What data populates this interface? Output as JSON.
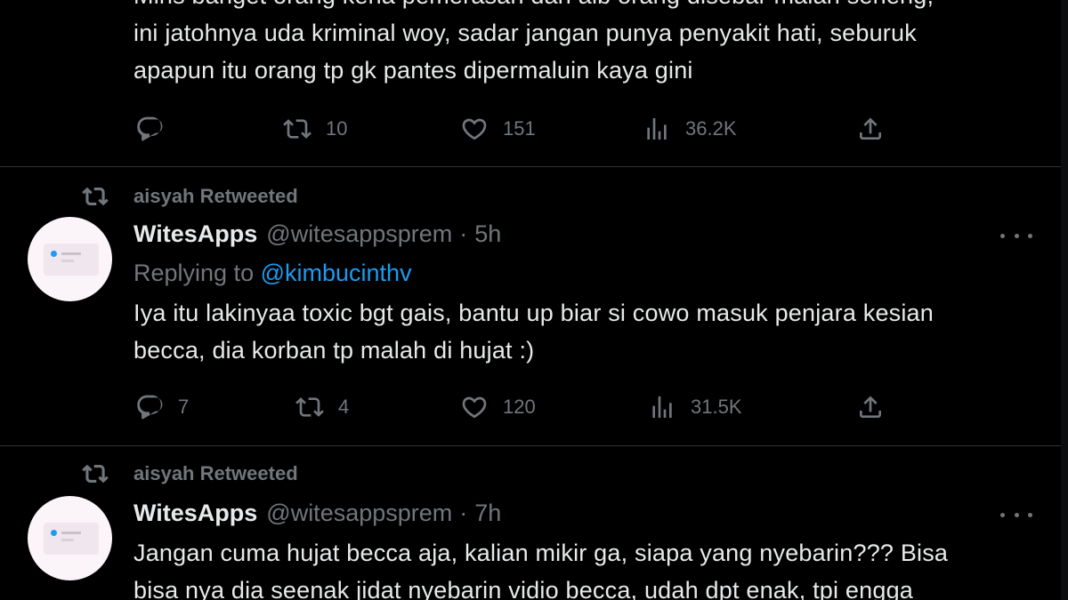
{
  "top_tweet": {
    "lines": [
      "Mihs banget orang kena pemerasan dan aib orang disebar malah seneng,",
      "ini jatohnya uda kriminal woy, sadar jangan punya penyakit hati, seburuk",
      "apapun itu orang tp gk pantes dipermaluin kaya gini"
    ],
    "actions": {
      "replies": "",
      "retweets": "10",
      "likes": "151",
      "views": "36.2K"
    }
  },
  "tweets": [
    {
      "retweeted_by": "aisyah Retweeted",
      "name": "WitesApps",
      "handle": "@witesappsprem",
      "sep": "·",
      "time": "5h",
      "replying_prefix": "Replying to",
      "replying_to": "@kimbucinthv",
      "lines": [
        "Iya itu lakinyaa toxic bgt gais, bantu up biar si cowo masuk penjara kesian",
        "becca, dia korban tp malah di hujat :)"
      ],
      "actions": {
        "replies": "7",
        "retweets": "4",
        "likes": "120",
        "views": "31.5K"
      }
    },
    {
      "retweeted_by": "aisyah Retweeted",
      "name": "WitesApps",
      "handle": "@witesappsprem",
      "sep": "·",
      "time": "7h",
      "lines": [
        "Jangan cuma hujat becca aja, kalian mikir ga, siapa yang nyebarin??? Bisa",
        "bisa nya dia seenak jidat nyebarin vidio becca, udah dpt enak, tpi engga"
      ]
    }
  ],
  "icons": {
    "reply": "reply-icon",
    "retweet": "retweet-icon",
    "like": "heart-icon",
    "views": "views-icon",
    "share": "share-icon",
    "more": "more-icon"
  },
  "colors": {
    "background": "#000000",
    "text": "#e7e9ea",
    "muted": "#71767b",
    "accent": "#1d9bf0",
    "divider": "#2f3336"
  }
}
